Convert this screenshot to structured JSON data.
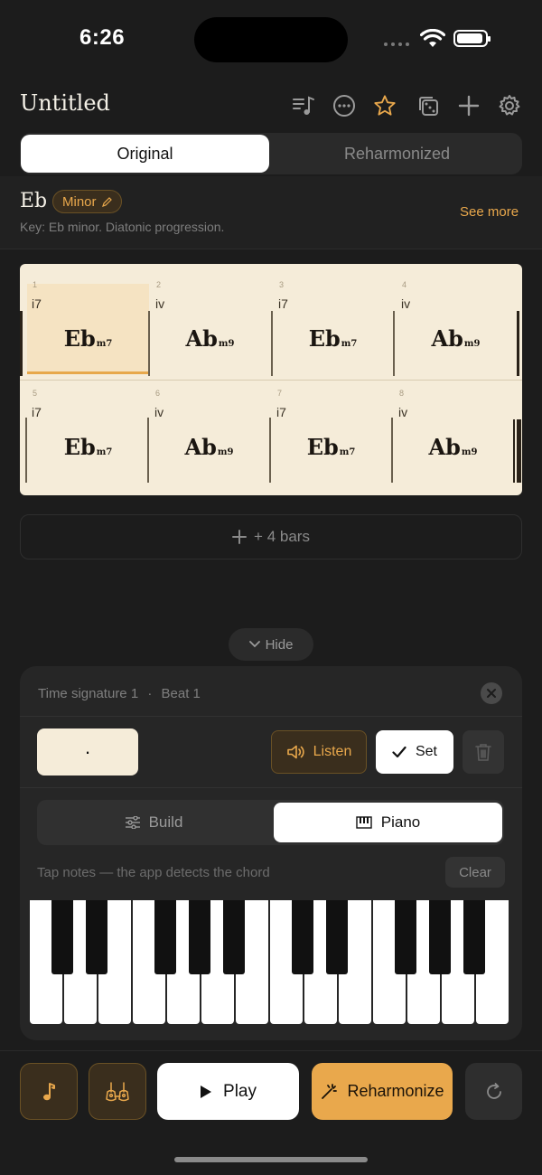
{
  "status": {
    "time": "6:26"
  },
  "header": {
    "title": "Untitled",
    "icons": [
      "music-list-icon",
      "more-icon",
      "star-icon",
      "dice-icon",
      "plus-icon",
      "gear-icon"
    ]
  },
  "tabs": {
    "original": "Original",
    "reharmonized": "Reharmonized"
  },
  "key": {
    "name": "Eb",
    "mode": "Minor",
    "description": "Key: Eb minor. Diatonic progression.",
    "see_more": "See more"
  },
  "progression": {
    "bars": [
      {
        "num": "1",
        "roman": "i7",
        "root": "Eb",
        "quality": "m7"
      },
      {
        "num": "2",
        "roman": "iv",
        "root": "Ab",
        "quality": "m9"
      },
      {
        "num": "3",
        "roman": "i7",
        "root": "Eb",
        "quality": "m7"
      },
      {
        "num": "4",
        "roman": "iv",
        "root": "Ab",
        "quality": "m9"
      },
      {
        "num": "5",
        "roman": "i7",
        "root": "Eb",
        "quality": "m7"
      },
      {
        "num": "6",
        "roman": "iv",
        "root": "Ab",
        "quality": "m9"
      },
      {
        "num": "7",
        "roman": "i7",
        "root": "Eb",
        "quality": "m7"
      },
      {
        "num": "8",
        "roman": "iv",
        "root": "Ab",
        "quality": "m9"
      }
    ]
  },
  "add_bars": {
    "label": "+ 4 bars"
  },
  "hide": {
    "label": "Hide"
  },
  "editor": {
    "time_signature": "Time signature 1",
    "beat": "Beat 1",
    "chord_value": "·",
    "listen": "Listen",
    "set": "Set",
    "modes": {
      "build": "Build",
      "piano": "Piano"
    },
    "hint": "Tap notes — the app detects the chord",
    "clear": "Clear"
  },
  "bottom": {
    "play": "Play",
    "reharmonize": "Reharmonize"
  },
  "colors": {
    "accent": "#e9a84c",
    "paper": "#f5ecd9",
    "background": "#1c1c1c"
  }
}
